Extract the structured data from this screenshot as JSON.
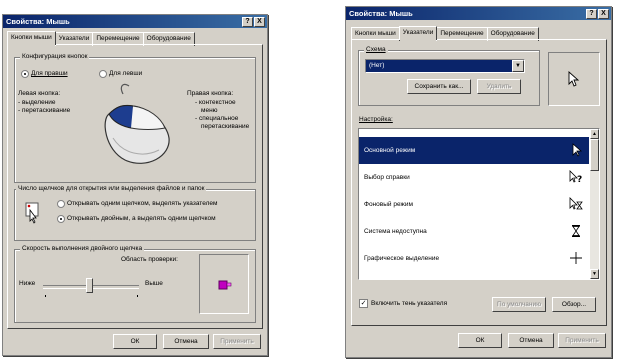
{
  "left_window": {
    "title": "Свойства: Мышь",
    "title_buttons": [
      "?",
      "X"
    ],
    "tabs": [
      "Кнопки мыши",
      "Указатели",
      "Перемещение",
      "Оборудование"
    ],
    "active_tab": "Кнопки мыши",
    "button_config": {
      "title": "Конфигурация кнопок",
      "right_handed": "Для правши",
      "left_handed": "Для левши",
      "left_button_title": "Левая кнопка:",
      "left_button_lines": [
        "- выделение",
        "- перетаскивание"
      ],
      "right_button_title": "Правая кнопка:",
      "right_button_lines": [
        "- контекстное",
        "меню",
        "- специальное",
        "перетаскивание"
      ]
    },
    "clicks": {
      "title": "Число щелчков для открытия или выделения файлов и папок",
      "single": "Открывать одним щелчком, выделять указателем",
      "double": "Открывать двойным, а выделять одним щелчком"
    },
    "speed": {
      "title": "Скорость выполнения двойного щелчка",
      "test_area": "Область проверки:",
      "low": "Ниже",
      "high": "Выше",
      "slider_level": 0.5
    },
    "buttons": {
      "ok": "ОК",
      "cancel": "Отмена",
      "apply": "Применить"
    }
  },
  "right_window": {
    "title": "Свойства: Мышь",
    "title_buttons": [
      "?",
      "X"
    ],
    "tabs": [
      "Кнопки мыши",
      "Указатели",
      "Перемещение",
      "Оборудование"
    ],
    "active_tab": "Указатели",
    "scheme": {
      "title": "Схема",
      "value": "(Нет)",
      "save_as": "Сохранить как...",
      "delete": "Удалить"
    },
    "settings_label": "Настройка:",
    "pointers": [
      {
        "label": "Основной режим",
        "icon": "arrow-pointer-icon",
        "selected": true
      },
      {
        "label": "Выбор справки",
        "icon": "help-select-icon",
        "selected": false
      },
      {
        "label": "Фоновый режим",
        "icon": "working-background-icon",
        "selected": false
      },
      {
        "label": "Система недоступна",
        "icon": "hourglass-icon",
        "selected": false
      },
      {
        "label": "Графическое выделение",
        "icon": "crosshair-icon",
        "selected": false
      }
    ],
    "shadow_checkbox": "Включить тень указателя",
    "shadow_checked": true,
    "default_button": "По умолчанию",
    "browse_button": "Обзор...",
    "buttons": {
      "ok": "ОК",
      "cancel": "Отмена",
      "apply": "Применить"
    }
  }
}
